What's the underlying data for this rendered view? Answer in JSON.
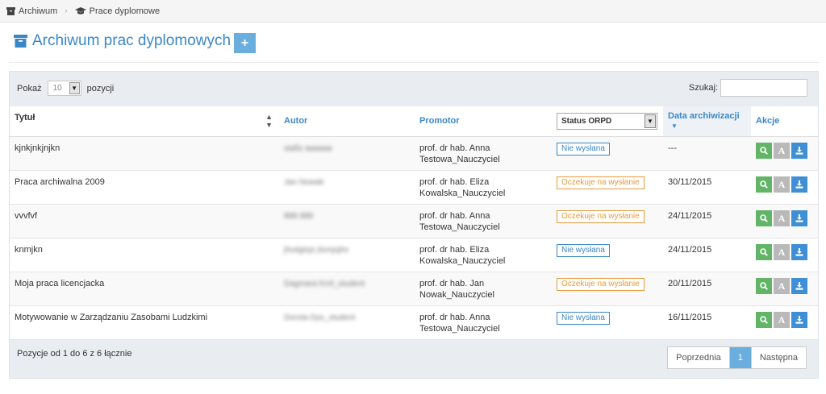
{
  "breadcrumb": [
    {
      "icon": "archive-icon",
      "label": "Archiwum"
    },
    {
      "icon": "graduation-cap-icon",
      "label": "Prace dyplomowe"
    }
  ],
  "page": {
    "title": "Archiwum prac dyplomowych",
    "add_label": "+"
  },
  "controls": {
    "show_prefix": "Pokaż",
    "show_value": "10",
    "show_suffix": "pozycji",
    "search_label": "Szukaj:",
    "search_value": ""
  },
  "columns": {
    "title": "Tytuł",
    "author": "Autor",
    "promoter": "Promotor",
    "status_select": "Status ORPD",
    "date": "Data archiwizacji",
    "actions": "Akcje"
  },
  "rows": [
    {
      "title": "kjnkjnkjnjkn",
      "author": "stafis aaaaaa",
      "promoter": "prof. dr hab. Anna Testowa_Nauczyciel",
      "status": "Nie wysłana",
      "status_color": "#3a87c8",
      "date": "---"
    },
    {
      "title": "Praca archiwalna 2009",
      "author": "Jan Nowak",
      "promoter": "prof. dr hab. Eliza Kowalska_Nauczyciel",
      "status": "Oczekuje na wysłanie",
      "status_color": "#e89a3c",
      "date": "30/11/2015"
    },
    {
      "title": "vvvfvf",
      "author": "888 888",
      "promoter": "prof. dr hab. Anna Testowa_Nauczyciel",
      "status": "Oczekuje na wysłanie",
      "status_color": "#e89a3c",
      "date": "24/11/2015"
    },
    {
      "title": "knmjkn",
      "author": "jhsdgtsjs jtsmjsjhs",
      "promoter": "prof. dr hab. Eliza Kowalska_Nauczyciel",
      "status": "Nie wysłana",
      "status_color": "#3a87c8",
      "date": "24/11/2015"
    },
    {
      "title": "Moja praca licencjacka",
      "author": "Dagmara Król_student",
      "promoter": "prof. dr hab. Jan Nowak_Nauczyciel",
      "status": "Oczekuje na wysłanie",
      "status_color": "#e89a3c",
      "date": "20/11/2015"
    },
    {
      "title": "Motywowanie w Zarządzaniu Zasobami Ludzkimi",
      "author": "Dorota Dys_student",
      "promoter": "prof. dr hab. Anna Testowa_Nauczyciel",
      "status": "Nie wysłana",
      "status_color": "#3a87c8",
      "date": "16/11/2015"
    }
  ],
  "footer": {
    "info": "Pozycje od 1 do 6 z 6 łącznie",
    "prev": "Poprzednia",
    "page": "1",
    "next": "Następna"
  },
  "colors": {
    "accent": "#3a87c8",
    "button_blue": "#6aaede",
    "green": "#62b567",
    "gray": "#b9b9b9",
    "orange": "#e89a3c"
  }
}
